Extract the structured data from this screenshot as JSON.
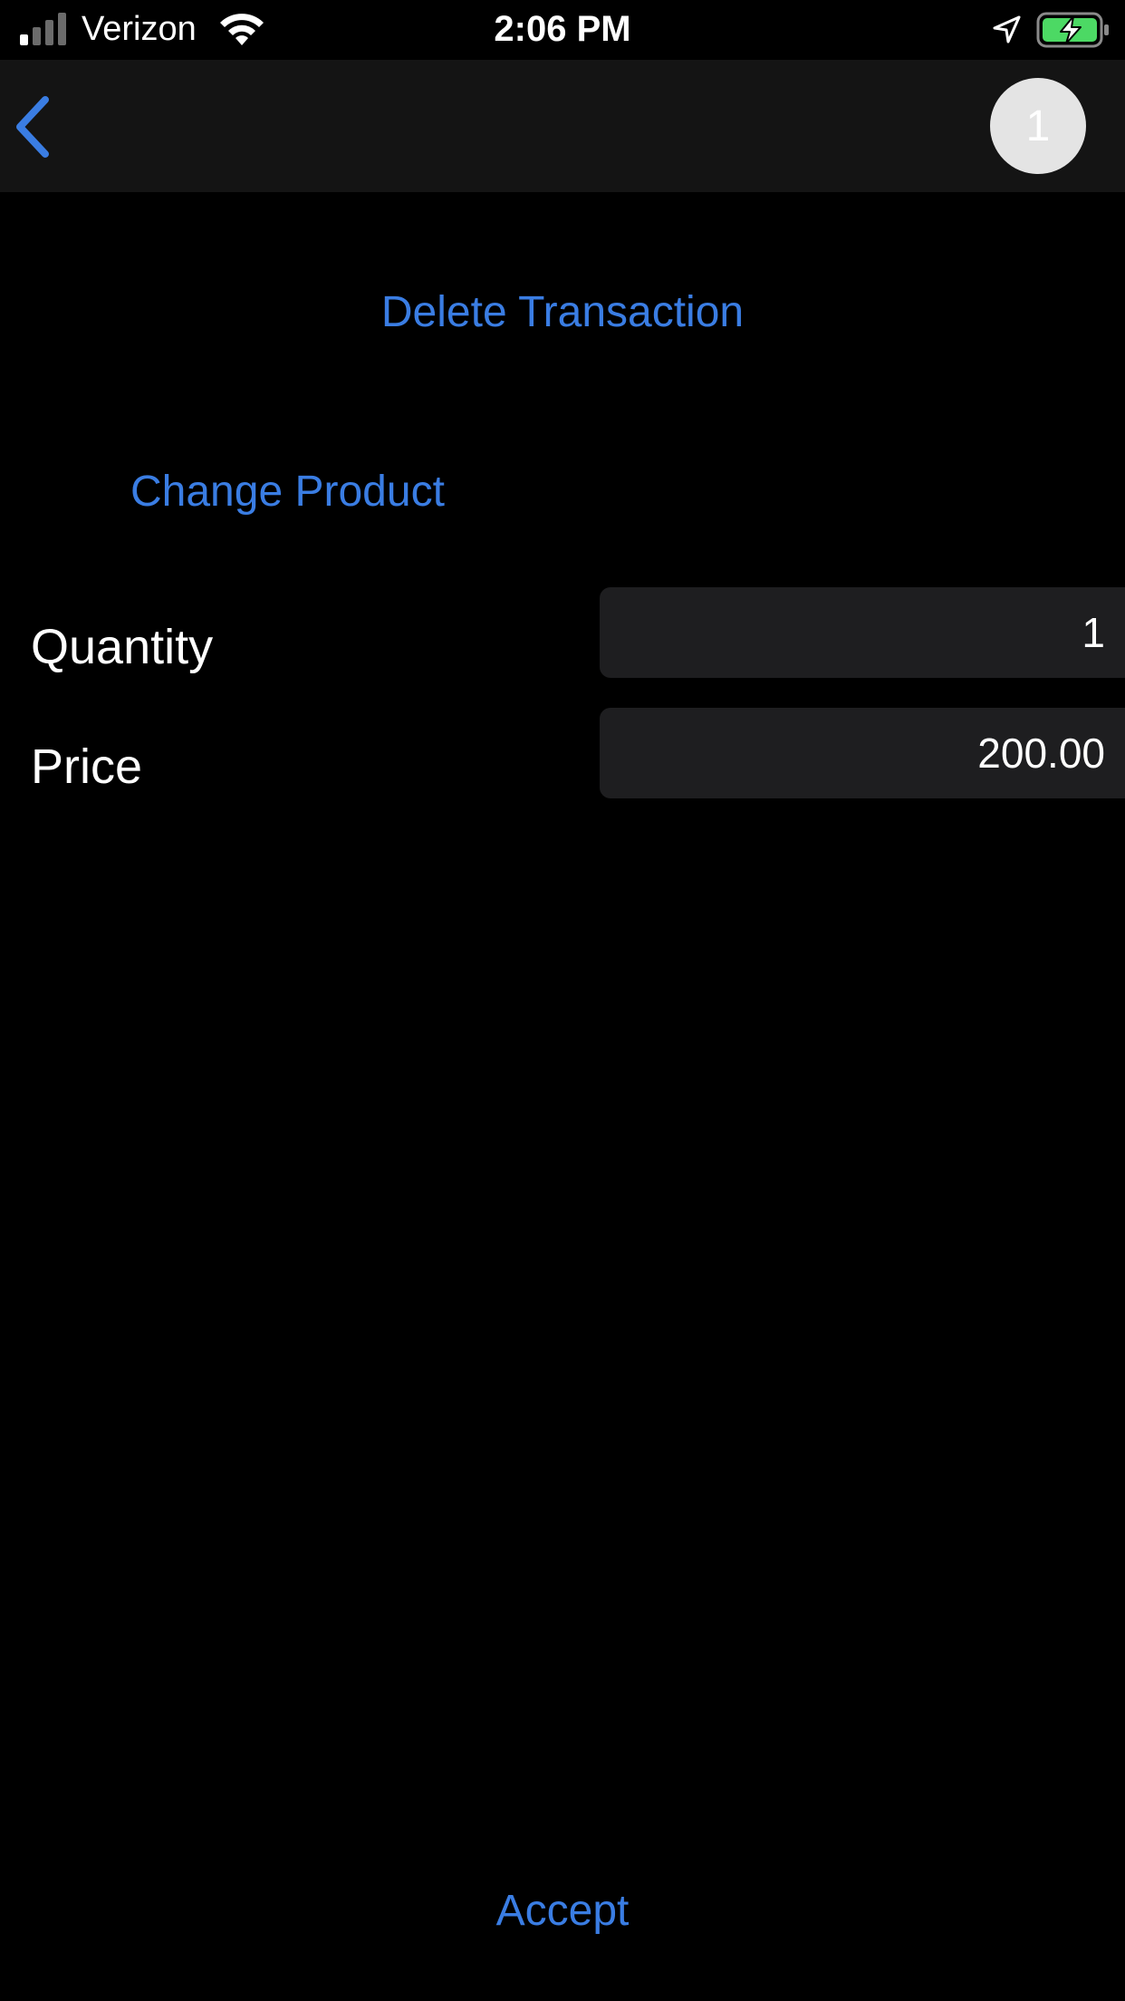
{
  "status_bar": {
    "carrier": "Verizon",
    "time": "2:06 PM",
    "icons": [
      "signal-icon",
      "wifi-icon",
      "location-arrow-icon",
      "battery-charging-icon"
    ]
  },
  "nav": {
    "back_icon": "chevron-left-icon",
    "badge_count": "1"
  },
  "actions": {
    "delete_label": "Delete Transaction",
    "change_product_label": "Change Product",
    "accept_label": "Accept"
  },
  "form": {
    "quantity_label": "Quantity",
    "quantity_value": "1",
    "price_label": "Price",
    "price_value": "200.00"
  },
  "colors": {
    "accent": "#3a7de3",
    "background": "#000000",
    "nav_background": "#141414",
    "input_background": "#1e1e20",
    "battery_charging": "#4cd964"
  }
}
